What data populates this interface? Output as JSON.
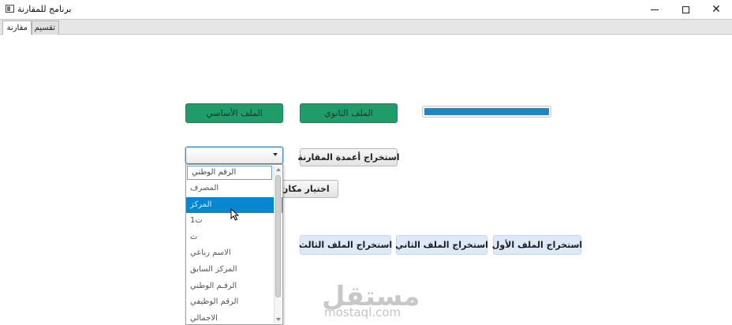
{
  "window": {
    "title": "برنامج للمقارنة",
    "controls": {
      "minimize": "minimize",
      "maximize": "maximize",
      "close": "close"
    }
  },
  "tabs": [
    {
      "label": "مقارنة",
      "active": true
    },
    {
      "label": "تقسيم",
      "active": false
    }
  ],
  "buttons": {
    "main_file": "الملف الأساسي",
    "secondary_file": "الملف الثانوي",
    "extract_columns": "استخراج أعمدة المقارنة",
    "choose_location": "اختيار مكان",
    "extract_first": "استخراج الملف الأول",
    "extract_second": "استخراج الملف الثاني",
    "extract_third": "استخراج الملف الثالث"
  },
  "progress": {
    "value": 1.0,
    "color": "#1a87c7"
  },
  "combo": {
    "value": ""
  },
  "dropdown": {
    "items": [
      "الرقم الوطني",
      "المصرف",
      "المركز",
      "ت1",
      "ث",
      "الاسم رباعي",
      "المركز السابق",
      "الرقـم الوطني",
      "الرقم الوظيفي",
      "الاجمالي"
    ],
    "selected_index": 2
  },
  "watermark": {
    "logo": "مستقل",
    "url": "mostaql.com"
  },
  "colors": {
    "green_button": "#1f9c6a",
    "selection": "#0a86d1",
    "light_button": "#dde9f7"
  }
}
